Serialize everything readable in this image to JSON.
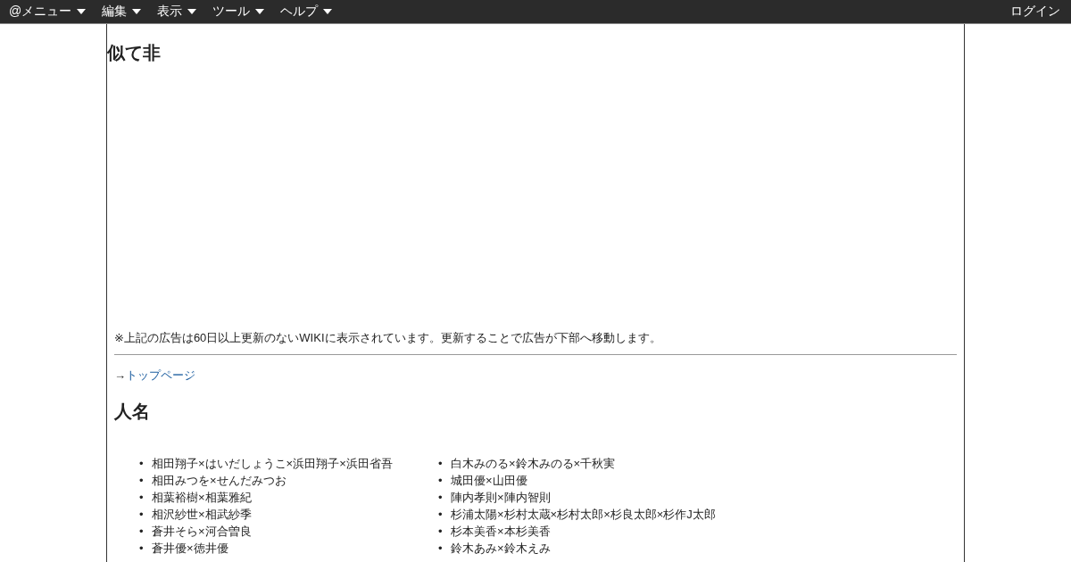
{
  "menu_bar": {
    "menus": [
      {
        "label": "@メニュー"
      },
      {
        "label": "編集"
      },
      {
        "label": "表示"
      },
      {
        "label": "ツール"
      },
      {
        "label": "ヘルプ"
      }
    ],
    "login": "ログイン"
  },
  "page": {
    "title": "似て非",
    "ad_notice": "※上記の広告は60日以上更新のないWIKIに表示されています。更新することで広告が下部へ移動します。",
    "back_arrow": "→",
    "top_link": "トップページ",
    "section_heading": "人名",
    "columns": [
      [
        {
          "marker": "•",
          "name": "相田翔子×はいだしょうこ×浜田翔子×浜田省吾"
        },
        {
          "marker": "•",
          "name": "相田みつを×せんだみつお"
        },
        {
          "marker": "•",
          "name": "相葉裕樹×相葉雅紀"
        },
        {
          "marker": "•",
          "name": "相沢紗世×相武紗季"
        },
        {
          "marker": "•",
          "name": "蒼井そら×河合曽良"
        },
        {
          "marker": "•",
          "name": "蒼井優×徳井優"
        }
      ],
      [
        {
          "marker": "•",
          "name": "白木みのる×鈴木みのる×千秋実"
        },
        {
          "marker": "•",
          "name": "城田優×山田優"
        },
        {
          "marker": "•",
          "name": "陣内孝則×陣内智則"
        },
        {
          "marker": "•",
          "name": "杉浦太陽×杉村太蔵×杉村太郎×杉良太郎×杉作J太郎"
        },
        {
          "marker": "•",
          "name": "杉本美香×本杉美香"
        },
        {
          "marker": "•",
          "name": "鈴木あみ×鈴木えみ"
        }
      ]
    ]
  }
}
